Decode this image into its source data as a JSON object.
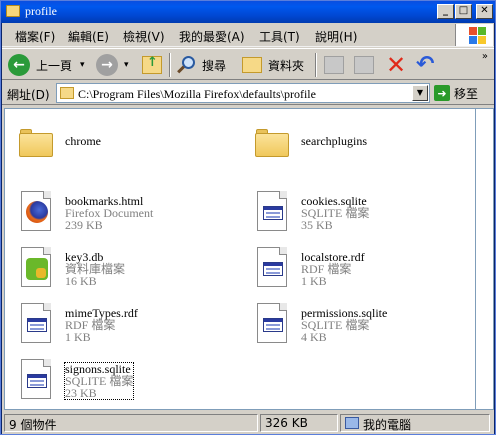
{
  "window": {
    "title": "profile"
  },
  "menu": [
    "檔案(F)",
    "編輯(E)",
    "檢視(V)",
    "我的最愛(A)",
    "工具(T)",
    "說明(H)"
  ],
  "toolbar": {
    "back_label": "上一頁",
    "search_label": "搜尋",
    "folders_label": "資料夾"
  },
  "address": {
    "label": "網址(D)",
    "value": "C:\\Program Files\\Mozilla Firefox\\defaults\\profile",
    "go_label": "移至"
  },
  "files": [
    {
      "name": "chrome",
      "kind": "folder",
      "type": "",
      "size": ""
    },
    {
      "name": "searchplugins",
      "kind": "folder",
      "type": "",
      "size": ""
    },
    {
      "name": "bookmarks.html",
      "kind": "firefox",
      "type": "Firefox Document",
      "size": "239 KB"
    },
    {
      "name": "cookies.sqlite",
      "kind": "doc",
      "type": "SQLITE 檔案",
      "size": "35 KB"
    },
    {
      "name": "key3.db",
      "kind": "puzzle",
      "type": "資料庫檔案",
      "size": "16 KB"
    },
    {
      "name": "localstore.rdf",
      "kind": "doc",
      "type": "RDF 檔案",
      "size": "1 KB"
    },
    {
      "name": "mimeTypes.rdf",
      "kind": "doc",
      "type": "RDF 檔案",
      "size": "1 KB"
    },
    {
      "name": "permissions.sqlite",
      "kind": "doc",
      "type": "SQLITE 檔案",
      "size": "4 KB"
    },
    {
      "name": "signons.sqlite",
      "kind": "doc",
      "type": "SQLITE 檔案",
      "size": "23 KB"
    }
  ],
  "status": {
    "count": "9 個物件",
    "size": "326 KB",
    "location": "我的電腦"
  }
}
